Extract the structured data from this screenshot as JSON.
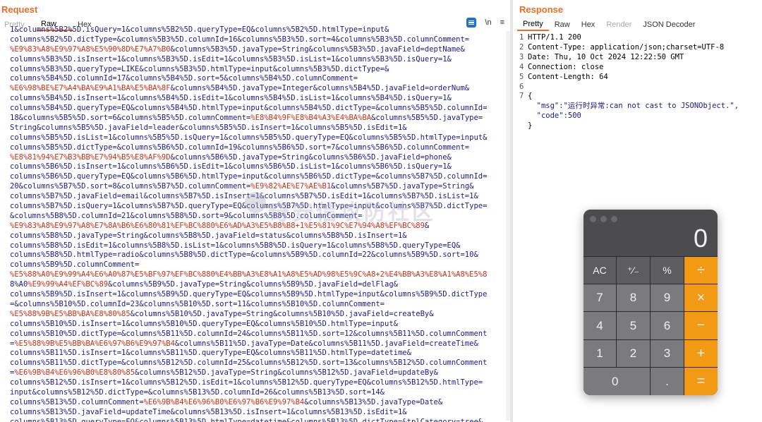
{
  "request": {
    "title": "Request",
    "tabs": [
      "Pretty",
      "Raw",
      "Hex"
    ],
    "active_tab": "Raw",
    "icons": [
      "wrap-lines-icon",
      "newline-icon",
      "menu-icon"
    ],
    "newline_label": "\\n",
    "menu_glyph": "≡",
    "body_lines": [
      "1&columns%5B2%5D.isQuery=1&columns%5B2%5D.queryType=EQ&columns%5B2%5D.htmlType=input&",
      "columns%5B2%5D.dictType=&columns%5B3%5D.columnId=16&columns%5B3%5D.sort=4&columns%5B3%5D.columnComment=",
      "%E9%83%A8%E9%97%A8%E5%90%8D%E7%A7%B0&columns%5B3%5D.javaType=String&columns%5B3%5D.javaField=deptName&",
      "columns%5B3%5D.isInsert=1&columns%5B3%5D.isEdit=1&columns%5B3%5D.isList=1&columns%5B3%5D.isQuery=1&",
      "columns%5B3%5D.queryType=LIKE&columns%5B3%5D.htmlType=input&columns%5B3%5D.dictType=&",
      "columns%5B4%5D.columnId=17&columns%5B4%5D.sort=5&columns%5B4%5D.columnComment=",
      "%E6%98%BE%E7%A4%BA%E9%A1%BA%E5%BA%8F&columns%5B4%5D.javaType=Integer&columns%5B4%5D.javaField=orderNum&",
      "columns%5B4%5D.isInsert=1&columns%5B4%5D.isEdit=1&columns%5B4%5D.isList=1&columns%5B4%5D.isQuery=1&",
      "columns%5B4%5D.queryType=EQ&columns%5B4%5D.htmlType=input&columns%5B4%5D.dictType=&columns%5B5%5D.columnId=",
      "18&columns%5B5%5D.sort=6&columns%5B5%5D.columnComment=%E8%B4%9F%E8%B4%A3%E4%BA%BA&columns%5B5%5D.javaType=",
      "String&columns%5B5%5D.javaField=leader&columns%5B5%5D.isInsert=1&columns%5B5%5D.isEdit=1&",
      "columns%5B5%5D.isList=1&columns%5B5%5D.isQuery=1&columns%5B5%5D.queryType=EQ&columns%5B5%5D.htmlType=input&",
      "columns%5B5%5D.dictType=&columns%5B6%5D.columnId=19&columns%5B6%5D.sort=7&columns%5B6%5D.columnComment=",
      "%E8%81%94%E7%B3%BB%E7%94%B5%E8%AF%9D&columns%5B6%5D.javaType=String&columns%5B6%5D.javaField=phone&",
      "columns%5B6%5D.isInsert=1&columns%5B6%5D.isEdit=1&columns%5B6%5D.isList=1&columns%5B6%5D.isQuery=1&",
      "columns%5B6%5D.queryType=EQ&columns%5B6%5D.htmlType=input&columns%5B6%5D.dictType=&columns%5B7%5D.columnId=",
      "20&columns%5B7%5D.sort=8&columns%5B7%5D.columnComment=%E9%82%AE%E7%AE%B1&columns%5B7%5D.javaType=String&",
      "columns%5B7%5D.javaField=email&columns%5B7%5D.isInsert=1&columns%5B7%5D.isEdit=1&columns%5B7%5D.isList=1&",
      "columns%5B7%5D.isQuery=1&columns%5B7%5D.queryType=EQ&columns%5B7%5D.htmlType=input&columns%5B7%5D.dictType=",
      "&columns%5B8%5D.columnId=21&columns%5B8%5D.sort=9&columns%5B8%5D.columnComment=",
      "%E9%83%A8%E9%97%A8%E7%8A%B6%E6%80%81%EF%BC%880%E6%AD%A3%E5%B8%B8+1%E5%81%9C%E7%94%A8%EF%BC%89&",
      "columns%5B8%5D.javaType=String&columns%5B8%5D.javaField=status&columns%5B8%5D.isInsert=1&",
      "columns%5B8%5D.isEdit=1&columns%5B8%5D.isList=1&columns%5B8%5D.isQuery=1&columns%5B8%5D.queryType=EQ&",
      "columns%5B8%5D.htmlType=radio&columns%5B8%5D.dictType=&columns%5B9%5D.columnId=22&columns%5B9%5D.sort=10&",
      "columns%5B9%5D.columnComment=",
      "%E5%88%A0%E9%99%A4%E6%A0%87%E5%BF%97%EF%BC%880%E4%BB%A3%E8%A1%A8%E5%AD%98%E5%9C%A8+2%E4%BB%A3%E8%A1%A8%E5%8",
      "8%A0%E9%99%A4%EF%BC%89&columns%5B9%5D.javaType=String&columns%5B9%5D.javaField=delFlag&",
      "columns%5B9%5D.isInsert=1&columns%5B9%5D.queryType=EQ&columns%5B9%5D.htmlType=input&columns%5B9%5D.dictType",
      "=&columns%5B10%5D.columnId=23&columns%5B10%5D.sort=11&columns%5B10%5D.columnComment=",
      "%E5%88%9B%E5%BB%BA%E8%80%85&columns%5B10%5D.javaType=String&columns%5B10%5D.javaField=createBy&",
      "columns%5B10%5D.isInsert=1&columns%5B10%5D.queryType=EQ&columns%5B10%5D.htmlType=input&",
      "columns%5B10%5D.dictType=&columns%5B11%5D.columnId=24&columns%5B11%5D.sort=12&columns%5B11%5D.columnComment",
      "=%E5%88%9B%E5%BB%BA%E6%97%B6%E9%97%B4&columns%5B11%5D.javaType=Date&columns%5B11%5D.javaField=createTime&",
      "columns%5B11%5D.isInsert=1&columns%5B11%5D.queryType=EQ&columns%5B11%5D.htmlType=datetime&",
      "columns%5B11%5D.dictType=&columns%5B12%5D.columnId=25&columns%5B12%5D.sort=13&columns%5B12%5D.columnComment",
      "=%E6%9B%B4%E6%96%B0%E8%80%85&columns%5B12%5D.javaType=String&columns%5B12%5D.javaField=updateBy&",
      "columns%5B12%5D.isInsert=1&columns%5B12%5D.isEdit=1&columns%5B12%5D.queryType=EQ&columns%5B12%5D.htmlType=",
      "input&columns%5B12%5D.dictType=&columns%5B13%5D.columnId=26&columns%5B13%5D.sort=14&",
      "columns%5B13%5D.columnComment=%E6%9B%B4%E6%96%B0%E6%97%B6%E9%97%B4&columns%5B13%5D.javaType=Date&",
      "columns%5B13%5D.javaField=updateTime&columns%5B13%5D.isInsert=1&columns%5B13%5D.isEdit=1&",
      "columns%5B13%5D.queryType=EQ&columns%5B13%5D.htmlType=datetime&columns%5B13%5D.dictType=&tplCategory=tree&"
    ]
  },
  "response": {
    "title": "Response",
    "tabs": [
      "Pretty",
      "Raw",
      "Hex",
      "Render",
      "JSON Decoder"
    ],
    "active_tab": "Pretty",
    "lines": [
      {
        "n": "1",
        "text": "HTTP/1.1 200"
      },
      {
        "n": "2",
        "text": "Content-Type: application/json;charset=UTF-8"
      },
      {
        "n": "3",
        "text": "Date: Thu, 10 Oct 2024 12:22:50 GMT"
      },
      {
        "n": "4",
        "text": "Connection: close"
      },
      {
        "n": "5",
        "text": "Content-Length: 64"
      },
      {
        "n": "6",
        "text": ""
      },
      {
        "n": "7",
        "text": "{"
      },
      {
        "n": "",
        "text": "  \"msg\":\"运行时异常:can not cast to JSONObject.\","
      },
      {
        "n": "",
        "text": "  \"code\":500"
      },
      {
        "n": "",
        "text": "}"
      }
    ]
  },
  "watermark": {
    "text": "奇安信攻防社区"
  },
  "calculator": {
    "display": "0",
    "keys": [
      {
        "label": "AC",
        "kind": "fn"
      },
      {
        "label": "⁺∕₋",
        "kind": "fn"
      },
      {
        "label": "%",
        "kind": "fn"
      },
      {
        "label": "÷",
        "kind": "op"
      },
      {
        "label": "7",
        "kind": "num"
      },
      {
        "label": "8",
        "kind": "num"
      },
      {
        "label": "9",
        "kind": "num"
      },
      {
        "label": "×",
        "kind": "op"
      },
      {
        "label": "4",
        "kind": "num"
      },
      {
        "label": "5",
        "kind": "num"
      },
      {
        "label": "6",
        "kind": "num"
      },
      {
        "label": "−",
        "kind": "op"
      },
      {
        "label": "1",
        "kind": "num"
      },
      {
        "label": "2",
        "kind": "num"
      },
      {
        "label": "3",
        "kind": "num"
      },
      {
        "label": "+",
        "kind": "op"
      },
      {
        "label": "0",
        "kind": "zero"
      },
      {
        "label": ".",
        "kind": "num"
      },
      {
        "label": "=",
        "kind": "op"
      }
    ]
  }
}
